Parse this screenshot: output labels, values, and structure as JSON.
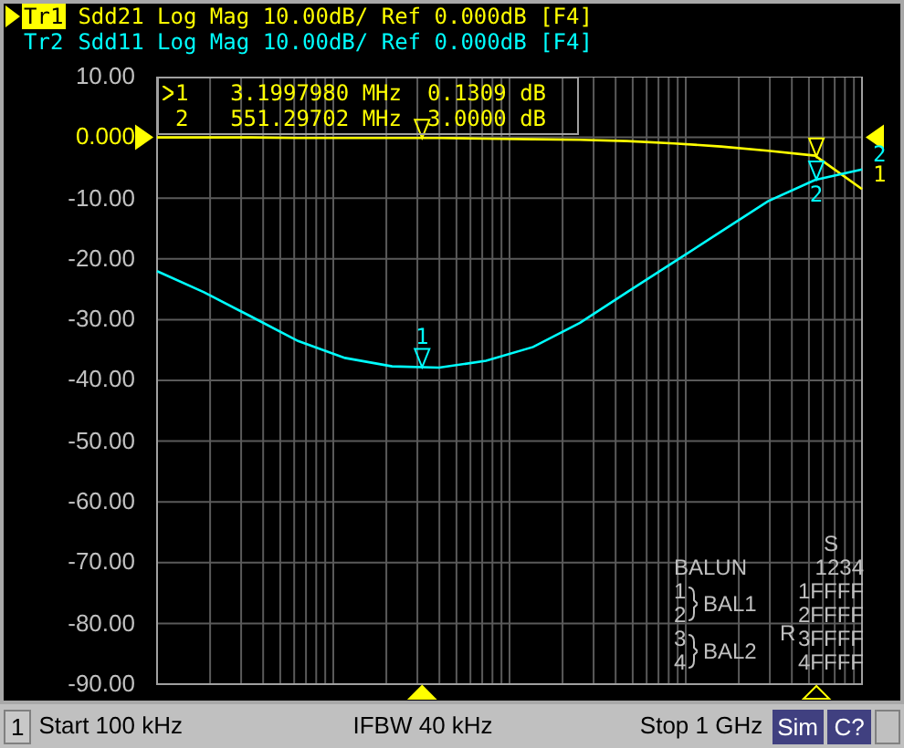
{
  "traces": [
    {
      "selected": true,
      "text": "Sdd21 Log Mag 10.00dB/ Ref 0.000dB [F4]"
    },
    {
      "selected": false,
      "text": "Sdd11 Log Mag 10.00dB/ Ref 0.000dB [F4]",
      "markers": [
        {
          "label": "1",
          "label_below": false
        },
        {
          "label": "2",
          "label_below": true
        }
      ]
    }
  ],
  "marker_readout": [
    {
      "number": "1",
      "selected": true,
      "frequency": "3.1997980 MHz",
      "value": "0.1309 dB"
    },
    {
      "number": "2",
      "selected": false,
      "frequency": "551.29702 MHz",
      "value": "3.0000 dB"
    }
  ],
  "chart_data": {
    "type": "line",
    "grid": true,
    "ylim": [
      -90,
      10
    ],
    "yticks": [
      {
        "value": 10,
        "label": "10.00"
      },
      {
        "value": 0,
        "label": "0.000"
      },
      {
        "value": -10,
        "label": "-10.00"
      },
      {
        "value": -20,
        "label": "-20.00"
      },
      {
        "value": -30,
        "label": "-30.00"
      },
      {
        "value": -40,
        "label": "-40.00"
      },
      {
        "value": -50,
        "label": "-50.00"
      },
      {
        "value": -60,
        "label": "-60.00"
      },
      {
        "value": -70,
        "label": "-70.00"
      },
      {
        "value": -80,
        "label": "-80.00"
      },
      {
        "value": -90,
        "label": "-90.00"
      }
    ],
    "categories": [
      null,
      null,
      null,
      null,
      null,
      null,
      null,
      null,
      null,
      null,
      null,
      null,
      null,
      null,
      null,
      null
    ],
    "series": [
      {
        "name": "Tr1",
        "color": "#ffff00",
        "values": [
          0,
          0,
          0,
          -0.1,
          -0.1,
          -0.1,
          -0.1,
          -0.2,
          -0.3,
          -0.4,
          -0.6,
          -1,
          -1.5,
          -2.2,
          -3,
          -8.5
        ]
      },
      {
        "name": "Tr2",
        "color": "#00ffff",
        "values": [
          -22,
          -25.5,
          -29.5,
          -33.5,
          -36.3,
          -37.7,
          -37.9,
          -36.8,
          -34.5,
          -30.5,
          -25.5,
          -20.5,
          -15.5,
          -10.5,
          -7,
          -5.3
        ]
      }
    ]
  },
  "scale": [
    {
      "reference": false
    },
    {
      "reference": true
    },
    {
      "reference": false
    },
    {
      "reference": false
    },
    {
      "reference": false
    },
    {
      "reference": false
    },
    {
      "reference": false
    },
    {
      "reference": false
    },
    {
      "reference": false
    },
    {
      "reference": false
    },
    {
      "reference": false
    }
  ],
  "end_labels": [
    {
      "label": "2",
      "color": "#00ffff"
    },
    {
      "label": "1",
      "color": "#ffff00"
    }
  ],
  "balun": {
    "title": "BALUN",
    "ports": [
      "1",
      "2",
      "3",
      "4"
    ],
    "groups": [
      "BAL1",
      "BAL2"
    ],
    "s_header": "S",
    "s_columns": "1234",
    "r_label": "R",
    "rows": [
      "1FFFF",
      "2FFFF",
      "3FFFF",
      "4FFFF"
    ]
  },
  "status_bar": {
    "channel": "1",
    "start": "Start 100 kHz",
    "ifbw": "IFBW 40 kHz",
    "stop": "Stop 1 GHz",
    "badges": [
      "Sim",
      "C?"
    ]
  }
}
